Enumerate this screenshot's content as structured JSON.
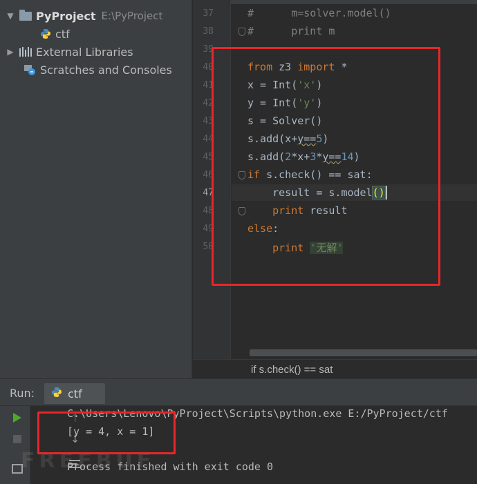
{
  "project": {
    "root_name": "PyProject",
    "root_path": "E:\\PyProject",
    "file": "ctf",
    "external_libraries": "External Libraries",
    "scratches": "Scratches and Consoles"
  },
  "editor": {
    "line_numbers": [
      "37",
      "38",
      "39",
      "40",
      "41",
      "42",
      "43",
      "44",
      "45",
      "46",
      "47",
      "48",
      "49",
      "50"
    ],
    "current_line": "47",
    "lines": {
      "l37_hash": "#",
      "l37_text": "m=solver.model()",
      "l38_hash": "#",
      "l38_text": "print m",
      "l40_from": "from",
      "l40_mod": " z3 ",
      "l40_import": "import",
      "l40_rest": " *",
      "l41_a": "x = Int(",
      "l41_s": "'x'",
      "l41_b": ")",
      "l42_a": "y = Int(",
      "l42_s": "'y'",
      "l42_b": ")",
      "l43": "s = Solver()",
      "l44_a": "s.add(x+",
      "l44_sq": "y==",
      "l44_n": "5",
      "l44_b": ")",
      "l45_a": "s.add(",
      "l45_n1": "2",
      "l45_b": "*x+",
      "l45_n2": "3",
      "l45_c": "*",
      "l45_sq": "y==",
      "l45_n3": "14",
      "l45_d": ")",
      "l46_if": "if",
      "l46_rest": " s.check() == sat:",
      "l47_a": "result = s.model",
      "l47_p": "()",
      "l48_kw": "print",
      "l48_rest": " result",
      "l49_kw": "else",
      "l49_rest": ":",
      "l50_kw": "print",
      "l50_str": "'无解'"
    },
    "breadcrumb": "if s.check() == sat"
  },
  "run": {
    "label": "Run:",
    "tab": "ctf",
    "output": [
      "C:\\Users\\Lenovo\\PyProject\\Scripts\\python.exe E:/PyProject/ctf",
      "[y = 4, x = 1]",
      "Process finished with exit code 0"
    ],
    "watermark": "FREEBUF"
  },
  "colors": {
    "keyword": "#cc7832",
    "string": "#6a8759",
    "number": "#6897bb",
    "annotation": "#e8262a",
    "run_green": "#4eaa25"
  }
}
